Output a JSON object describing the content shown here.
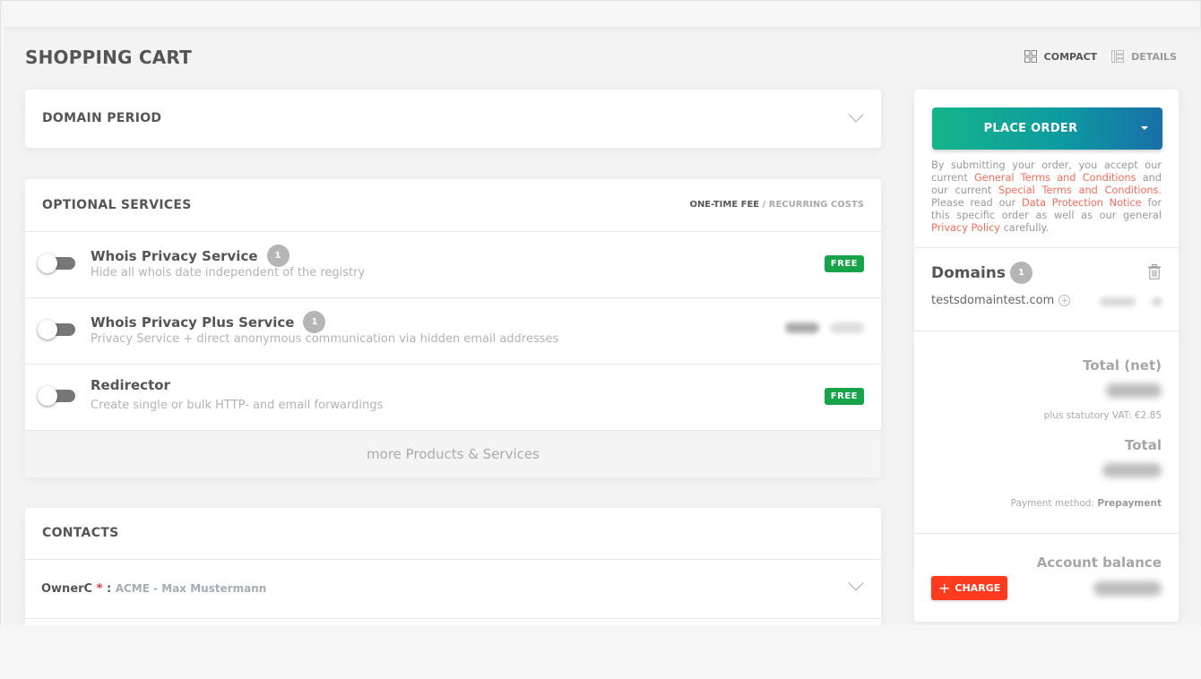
{
  "page": {
    "title": "SHOPPING CART"
  },
  "view_switch": {
    "compact_label": "COMPACT",
    "compact_icon": "grid-icon",
    "details_label": "DETAILS",
    "details_icon": "list-icon",
    "active": "compact"
  },
  "domain_period": {
    "title": "DOMAIN PERIOD",
    "icon": "chevron-down-icon"
  },
  "optional_services": {
    "title": "OPTIONAL SERVICES",
    "fee_toggle": {
      "active": "ONE-TIME FEE",
      "separator": " / ",
      "inactive": "RECURRING COSTS"
    },
    "items": [
      {
        "name": "Whois Privacy Service",
        "count": "1",
        "description": "Hide all whois date independent of the registry",
        "enabled": false,
        "price_badge": "FREE"
      },
      {
        "name": "Whois Privacy Plus Service",
        "count": "1",
        "description": "Privacy Service + direct anonymous communication via hidden email addresses",
        "enabled": false,
        "price_badge": null
      },
      {
        "name": "Redirector",
        "count": null,
        "description": "Create single or bulk HTTP- and email forwardings",
        "enabled": false,
        "price_badge": "FREE"
      }
    ],
    "more_label": "more Products & Services"
  },
  "contacts": {
    "title": "CONTACTS",
    "rows": [
      {
        "label": "OwnerC",
        "required_mark": "*",
        "separator": " : ",
        "value": "ACME - Max Mustermann"
      }
    ]
  },
  "sidebar": {
    "place_order_label": "PLACE ORDER",
    "terms": {
      "t1": "By submitting your order, you accept our current ",
      "link1": "General Terms and Conditions",
      "t2": " and our current ",
      "link2": "Special Terms and Conditions",
      "t3": ". Please read our ",
      "link3": "Data Protection Notice",
      "t4": " for this specific order as well as our general ",
      "link4": "Privacy Policy",
      "t5": " carefully."
    },
    "domains": {
      "title": "Domains",
      "count": "1",
      "items": [
        {
          "name": "testsdomaintest.com"
        }
      ]
    },
    "totals": {
      "net_label": "Total (net)",
      "vat_text": "plus statutory VAT: €2.85",
      "total_label": "Total",
      "payment_prefix": "Payment method: ",
      "payment_method": "Prepayment"
    },
    "account": {
      "balance_label": "Account balance",
      "charge_label": "CHARGE"
    }
  },
  "colors": {
    "accent_link": "#f26b5b",
    "free_badge": "#16a34a",
    "charge_button": "#ff3b1f",
    "place_order_gradient_start": "#14b58a",
    "place_order_gradient_end": "#1a6fa8"
  }
}
